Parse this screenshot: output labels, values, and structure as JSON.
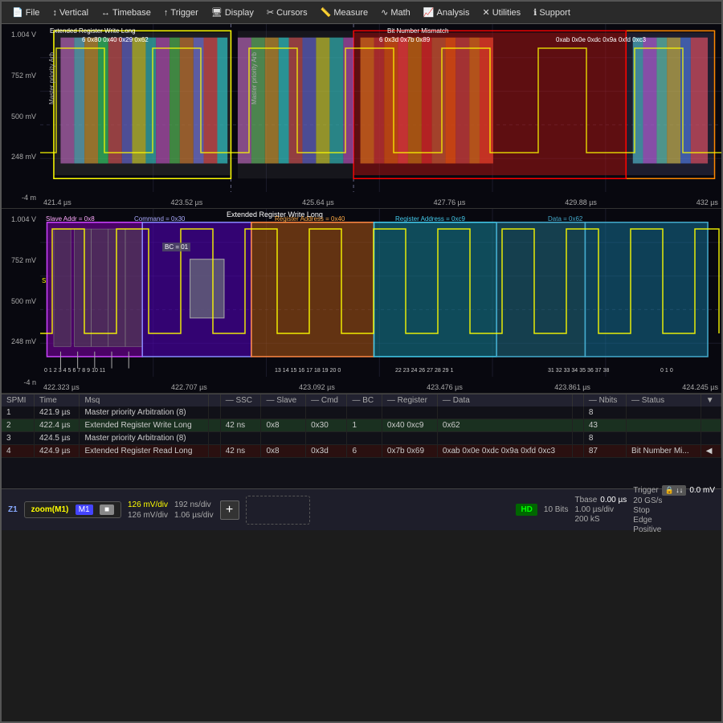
{
  "menu": {
    "items": [
      {
        "label": "File",
        "icon": "📄"
      },
      {
        "label": "Vertical",
        "icon": "↕"
      },
      {
        "label": "Timebase",
        "icon": "↔"
      },
      {
        "label": "Trigger",
        "icon": "↑"
      },
      {
        "label": "Display",
        "icon": "🖥"
      },
      {
        "label": "Cursors",
        "icon": "✂"
      },
      {
        "label": "Measure",
        "icon": "📏"
      },
      {
        "label": "Math",
        "icon": "∿"
      },
      {
        "label": "Analysis",
        "icon": "📈"
      },
      {
        "label": "Utilities",
        "icon": "✕"
      },
      {
        "label": "Support",
        "icon": "ℹ"
      }
    ]
  },
  "top_panel": {
    "y_labels": [
      "1.004 V",
      "752 mV",
      "500 mV",
      "248 mV",
      "-4 m"
    ],
    "x_labels": [
      "421.4 µs",
      "423.52 µs",
      "425.64 µs",
      "427.76 µs",
      "429.88 µs",
      "432 µs"
    ],
    "annotations": {
      "extended_write": "Extended Register Write Long",
      "bit_mismatch": "Bit Number Mismatch",
      "master_priority_1": "Master priority Arb",
      "master_priority_2": "Master priority Arb",
      "hex_values_1": "0x80  0x40  0x29  0x62",
      "hex_values_2": "0x3d  0x7b  0x89",
      "hex_values_3": "0xab  0x0e  0xdc  0x9a  0xfd  0xc3"
    }
  },
  "bottom_panel": {
    "title": "Extended Register Write Long",
    "y_labels": [
      "1.004 V",
      "752 mV",
      "500 mV",
      "248 mV",
      "-4 n"
    ],
    "x_labels": [
      "422.323 µs",
      "422.707 µs",
      "423.092 µs",
      "423.476 µs",
      "423.861 µs",
      "424.245 µs"
    ],
    "sections": {
      "slave_addr": "Slave Addr = 0x8",
      "command": "Command = 0x30",
      "bc": "BC = 01",
      "reg_addr": "Register Address = 0x40",
      "reg_addr2": "Register Address = 0xc9",
      "data": "Data = 0x62"
    },
    "bits": [
      "0",
      "1",
      "2",
      "3",
      "4",
      "5",
      "6",
      "7",
      "8",
      "9",
      "10",
      "11",
      "13",
      "14",
      "15",
      "16",
      "17",
      "18",
      "19",
      "20",
      "0",
      "22",
      "23",
      "24",
      "26",
      "27",
      "28",
      "29",
      "1",
      "31",
      "32",
      "33",
      "34",
      "35",
      "36",
      "37",
      "38",
      "0",
      "1",
      "0"
    ],
    "channel": "S"
  },
  "table": {
    "headers": [
      "SPMI",
      "Time",
      "Msq",
      "",
      "SSC",
      "Slave",
      "Cmd",
      "BC",
      "Register",
      "Data",
      "",
      "Nbits",
      "Status",
      ""
    ],
    "rows": [
      {
        "num": "1",
        "time": "421.9 µs",
        "msg": "Master priority Arbitration (8)",
        "ssc": "",
        "slave": "",
        "cmd": "",
        "bc": "",
        "reg": "",
        "data": "",
        "nbits": "8",
        "status": ""
      },
      {
        "num": "2",
        "time": "422.4 µs",
        "msg": "Extended Register Write Long",
        "ssc": "42 ns",
        "slave": "0x8",
        "cmd": "0x30",
        "bc": "1",
        "reg": "0x40 0xc9",
        "data": "0x62",
        "nbits": "43",
        "status": ""
      },
      {
        "num": "3",
        "time": "424.5 µs",
        "msg": "Master priority Arbitration (8)",
        "ssc": "",
        "slave": "",
        "cmd": "",
        "bc": "",
        "reg": "",
        "data": "",
        "nbits": "8",
        "status": ""
      },
      {
        "num": "4",
        "time": "424.9 µs",
        "msg": "Extended Register Read Long",
        "ssc": "42 ns",
        "slave": "0x8",
        "cmd": "0x3d",
        "bc": "6",
        "reg": "0x7b 0x69",
        "data": "0xab 0x0e 0xdc 0x9a 0xfd 0xc3",
        "nbits": "87",
        "status": "Bit Number Mi..."
      }
    ]
  },
  "statusbar": {
    "zoom_label": "zoom(M1)",
    "m1_label": "M1",
    "ch1_vdiv": "126 mV/div",
    "ch1_vdiv2": "126 mV/div",
    "ns_div": "192 ns/div",
    "ns_div2": "1.06 µs/div",
    "hd": "HD",
    "bits": "10 Bits",
    "tbase_label": "Tbase",
    "tbase_value": "0.00 µs",
    "sample_rate": "1.00 µs/div",
    "sample_rate2": "200 kS",
    "gs": "20 GS/s",
    "trigger_label": "Trigger",
    "trigger_value": "0.0 mV",
    "stop": "Stop",
    "edge": "Edge",
    "positive": "Positive"
  }
}
